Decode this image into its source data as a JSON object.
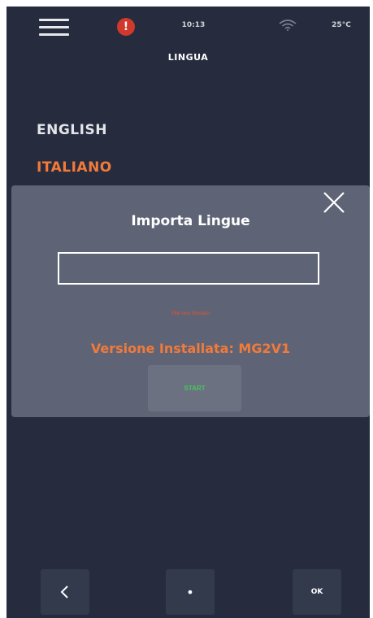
{
  "status_bar": {
    "time": "10:13",
    "temperature": "25°C",
    "alert_icon": "alert-icon",
    "alert_glyph": "!",
    "wifi_icon": "wifi-icon",
    "menu_icon": "hamburger-menu-icon"
  },
  "page": {
    "title": "LINGUA"
  },
  "languages": [
    {
      "label": "ENGLISH",
      "selected": false
    },
    {
      "label": "ITALIANO",
      "selected": true
    }
  ],
  "modal": {
    "title": "Importa Lingue",
    "file_input_value": "",
    "error_text": "File non trovato",
    "version_text": "Versione Installata: MG2V1",
    "start_label": "START",
    "close_icon": "close-icon"
  },
  "footer": {
    "back_icon": "chevron-left-icon",
    "dot_label": "•",
    "ok_label": "OK"
  },
  "colors": {
    "background": "#262c3d",
    "accent": "#f27a3a",
    "error": "#f0502c",
    "start": "#45c75a",
    "modal": "#5e6476"
  }
}
